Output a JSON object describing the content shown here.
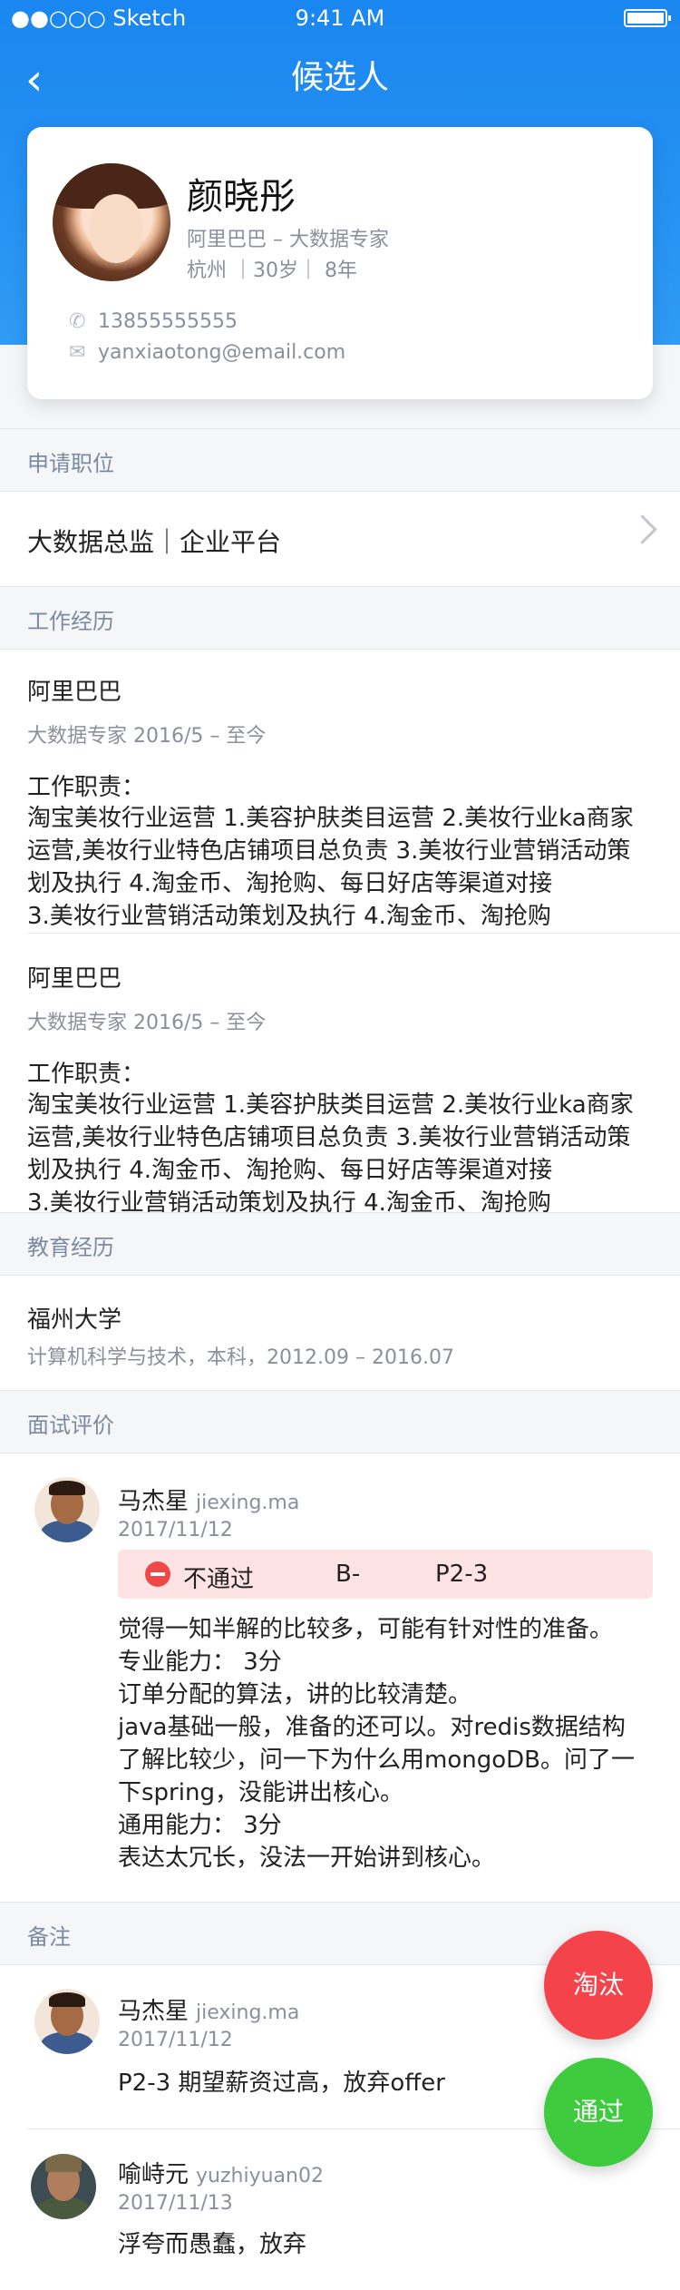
{
  "status_bar": {
    "carrier": "●●○○○ Sketch",
    "time": "9:41 AM"
  },
  "nav": {
    "title": "候选人"
  },
  "candidate": {
    "name": "颜晓彤",
    "company_title": "阿里巴巴 – 大数据专家",
    "meta": "杭州 ｜30岁｜ 8年",
    "phone": "13855555555",
    "email": "yanxiaotong@email.com"
  },
  "sections": {
    "position": "申请职位",
    "experience": "工作经历",
    "education": "教育经历",
    "review": "面试评价",
    "notes": "备注"
  },
  "applied_position": "大数据总监｜企业平台",
  "experience": [
    {
      "company": "阿里巴巴",
      "role": "大数据专家 2016/5 – 至今",
      "duty_title": "工作职责：",
      "duty_lines": [
        "淘宝美妆行业运营 1.美容护肤类目运营 2.美妆行业ka商家",
        "运营,美妆行业特色店铺项目总负责 3.美妆行业营销活动策",
        "划及执行 4.淘金币、淘抢购、每日好店等渠道对接",
        "3.美妆行业营销活动策划及执行 4.淘金币、淘抢购"
      ]
    },
    {
      "company": "阿里巴巴",
      "role": "大数据专家 2016/5 – 至今",
      "duty_title": "工作职责：",
      "duty_lines": [
        "淘宝美妆行业运营 1.美容护肤类目运营 2.美妆行业ka商家",
        "运营,美妆行业特色店铺项目总负责 3.美妆行业营销活动策",
        "划及执行 4.淘金币、淘抢购、每日好店等渠道对接",
        "3.美妆行业营销活动策划及执行 4.淘金币、淘抢购"
      ]
    }
  ],
  "education": {
    "school": "福州大学",
    "info": "计算机科学与技术，本科，2012.09 – 2016.07"
  },
  "review": {
    "name": "马杰星",
    "uid": "jiexing.ma",
    "date": "2017/11/12",
    "result": "不通过",
    "grade": "B-",
    "level": "P2-3",
    "lines": [
      "觉得一知半解的比较多，可能有针对性的准备。",
      "专业能力： 3分",
      "订单分配的算法，讲的比较清楚。",
      "java基础一般，准备的还可以。对redis数据结构",
      "了解比较少，问一下为什么用mongoDB。问了一",
      "下spring，没能讲出核心。",
      "通用能力： 3分",
      "表达太冗长，没法一开始讲到核心。"
    ]
  },
  "notes": [
    {
      "name": "马杰星",
      "uid": "jiexing.ma",
      "date": "2017/11/12",
      "text": "P2-3 期望薪资过高，放弃offer"
    },
    {
      "name": "喻峙元",
      "uid": "yuzhiyuan02",
      "date": "2017/11/13",
      "text": "浮夸而愚蠢，放弃"
    }
  ],
  "actions": {
    "reject": "淘汰",
    "pass": "通过"
  },
  "colors": {
    "primary": "#1a86f0",
    "reject": "#f5434b",
    "pass": "#3ecc3e"
  }
}
